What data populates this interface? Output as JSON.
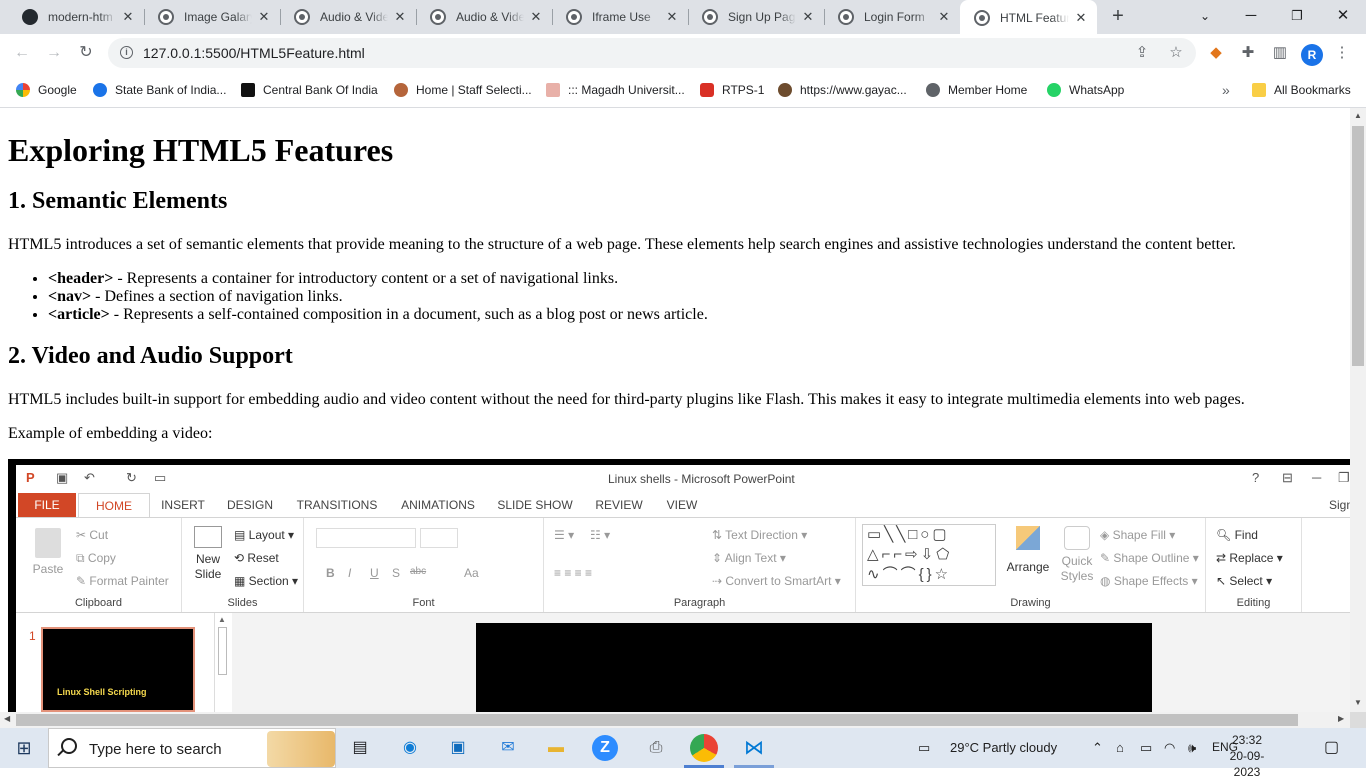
{
  "browser": {
    "tabs": [
      {
        "title": "modern-htm",
        "icon": "github-icon",
        "active": false
      },
      {
        "title": "Image Galary",
        "icon": "globe-icon",
        "active": false
      },
      {
        "title": "Audio & Vide",
        "icon": "globe-icon",
        "active": false
      },
      {
        "title": "Audio & Vide",
        "icon": "globe-icon",
        "active": false
      },
      {
        "title": "Iframe Use",
        "icon": "globe-icon",
        "active": false
      },
      {
        "title": "Sign Up Page",
        "icon": "globe-icon",
        "active": false
      },
      {
        "title": "Login Form",
        "icon": "globe-icon",
        "active": false
      },
      {
        "title": "HTML Featur",
        "icon": "globe-icon",
        "active": true
      }
    ],
    "url": "127.0.0.1:5500/HTML5Feature.html",
    "profile_initial": "R",
    "bookmarks": [
      {
        "label": "Google"
      },
      {
        "label": "State Bank of India..."
      },
      {
        "label": "Central Bank Of India"
      },
      {
        "label": "Home | Staff Selecti..."
      },
      {
        "label": "::: Magadh Universit..."
      },
      {
        "label": "RTPS-1"
      },
      {
        "label": "https://www.gayac..."
      },
      {
        "label": "Member Home"
      },
      {
        "label": "WhatsApp"
      }
    ],
    "all_bookmarks": "All Bookmarks",
    "bookmarks_overflow": "»"
  },
  "page": {
    "h1": "Exploring HTML5 Features",
    "section1": {
      "heading": "1. Semantic Elements",
      "text": "HTML5 introduces a set of semantic elements that provide meaning to the structure of a web page. These elements help search engines and assistive technologies understand the content better.",
      "items": [
        {
          "tag": "<header>",
          "desc": " - Represents a container for introductory content or a set of navigational links."
        },
        {
          "tag": "<nav>",
          "desc": " - Defines a section of navigation links."
        },
        {
          "tag": "<article>",
          "desc": " - Represents a self-contained composition in a document, such as a blog post or news article."
        }
      ]
    },
    "section2": {
      "heading": "2. Video and Audio Support",
      "text": "HTML5 includes built-in support for embedding audio and video content without the need for third-party plugins like Flash. This makes it easy to integrate multimedia elements into web pages.",
      "example": "Example of embedding a video:"
    }
  },
  "video": {
    "window_title": "Linux shells - Microsoft PowerPoint",
    "help": "?",
    "sign_in": "Sign",
    "ribbon_tabs": [
      "FILE",
      "HOME",
      "INSERT",
      "DESIGN",
      "TRANSITIONS",
      "ANIMATIONS",
      "SLIDE SHOW",
      "REVIEW",
      "VIEW"
    ],
    "clipboard": {
      "paste": "Paste",
      "cut": "Cut",
      "copy": "Copy",
      "format_painter": "Format Painter",
      "label": "Clipboard"
    },
    "slides": {
      "new_slide_1": "New",
      "new_slide_2": "Slide",
      "layout": "Layout",
      "reset": "Reset",
      "section": "Section",
      "label": "Slides"
    },
    "font": {
      "label": "Font",
      "bold": "B",
      "italic": "I",
      "underline": "U",
      "shadow": "S",
      "strike": "abc",
      "case": "Aa"
    },
    "paragraph": {
      "text_direction": "Text Direction",
      "align_text": "Align Text",
      "convert": "Convert to SmartArt",
      "label": "Paragraph"
    },
    "drawing": {
      "arrange": "Arrange",
      "quick_styles_1": "Quick",
      "quick_styles_2": "Styles",
      "shape_fill": "Shape Fill",
      "shape_outline": "Shape Outline",
      "shape_effects": "Shape Effects",
      "label": "Drawing"
    },
    "editing": {
      "find": "Find",
      "replace": "Replace",
      "select": "Select",
      "label": "Editing"
    },
    "slide_number": "1",
    "thumb_title": "Linux Shell Scripting"
  },
  "taskbar": {
    "search_placeholder": "Type here to search",
    "weather": "29°C  Partly cloudy",
    "lang": "ENG",
    "time": "23:32",
    "date": "20-09-2023"
  },
  "colors": {
    "accent": "#1a73e8",
    "ppt_red": "#d24726",
    "taskbar": "#dfe7f1"
  }
}
